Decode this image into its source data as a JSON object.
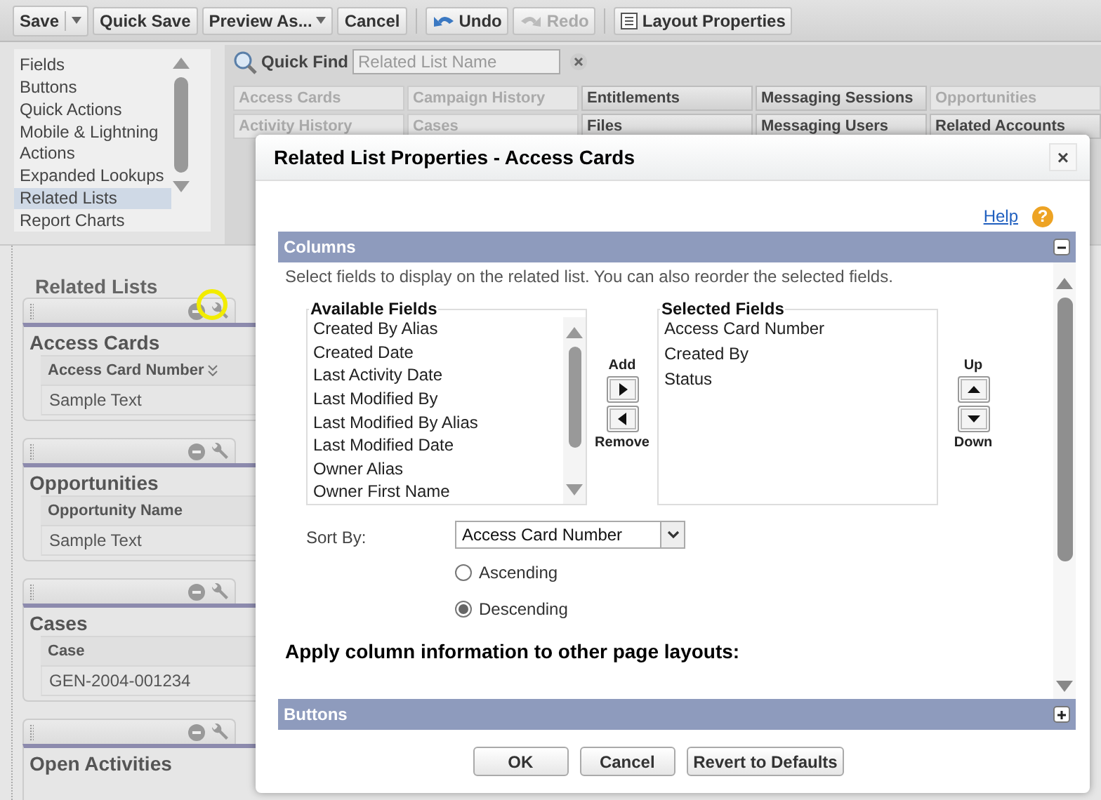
{
  "toolbar": {
    "groups": [
      [
        {
          "label": "Save",
          "kind": "split",
          "disabled": false
        },
        {
          "label": "Quick Save",
          "kind": "plain",
          "disabled": false
        },
        {
          "label": "Preview As...",
          "kind": "menu",
          "disabled": false
        },
        {
          "label": "Cancel",
          "kind": "plain",
          "disabled": false
        }
      ],
      [
        {
          "label": "Undo",
          "kind": "undo",
          "disabled": false
        },
        {
          "label": "Redo",
          "kind": "redo",
          "disabled": true
        }
      ],
      [
        {
          "label": "Layout Properties",
          "kind": "layout",
          "disabled": false
        }
      ]
    ]
  },
  "palette": {
    "categories": [
      {
        "label": "Fields",
        "selected": false
      },
      {
        "label": "Buttons",
        "selected": false
      },
      {
        "label": "Quick Actions",
        "selected": false
      },
      {
        "label": "Mobile & Lightning Actions",
        "selected": false
      },
      {
        "label": "Expanded Lookups",
        "selected": false
      },
      {
        "label": "Related Lists",
        "selected": true
      },
      {
        "label": "Report Charts",
        "selected": false
      }
    ],
    "quick_find": {
      "label": "Quick Find",
      "placeholder": "Related List Name"
    },
    "items": [
      {
        "label": "Access Cards",
        "in_use": true
      },
      {
        "label": "Campaign History",
        "in_use": true
      },
      {
        "label": "Entitlements",
        "in_use": false
      },
      {
        "label": "Messaging Sessions",
        "in_use": false
      },
      {
        "label": "Opportunities",
        "in_use": true
      },
      {
        "label": "Activity History",
        "in_use": true
      },
      {
        "label": "Cases",
        "in_use": true
      },
      {
        "label": "Files",
        "in_use": false
      },
      {
        "label": "Messaging Users",
        "in_use": false
      },
      {
        "label": "Related Accounts",
        "in_use": false
      }
    ]
  },
  "layout": {
    "section_title": "Related Lists",
    "related_lists": [
      {
        "title": "Access Cards",
        "column": "Access Card Number",
        "sorted": true,
        "value": "Sample Text",
        "highlighted": true
      },
      {
        "title": "Opportunities",
        "column": "Opportunity Name",
        "sorted": false,
        "value": "Sample Text",
        "highlighted": false
      },
      {
        "title": "Cases",
        "column": "Case",
        "sorted": false,
        "value": "GEN-2004-001234",
        "highlighted": false
      },
      {
        "title": "Open Activities",
        "highlighted": false
      }
    ]
  },
  "dialog": {
    "title": "Related List Properties - Access Cards",
    "close_glyph": "×",
    "help_link": "Help",
    "help_glyph": "?",
    "columns_section": {
      "title": "Columns",
      "expanded": true,
      "description": "Select fields to display on the related list. You can also reorder the selected fields.",
      "available_label": "Available Fields",
      "available_fields": [
        "Created By Alias",
        "Created Date",
        "Last Activity Date",
        "Last Modified By",
        "Last Modified By Alias",
        "Last Modified Date",
        "Owner Alias",
        "Owner First Name"
      ],
      "add_label": "Add",
      "remove_label": "Remove",
      "selected_label": "Selected Fields",
      "selected_fields": [
        "Access Card Number",
        "Created By",
        "Status"
      ],
      "up_label": "Up",
      "down_label": "Down",
      "sort_by_label": "Sort By:",
      "sort_by_value": "Access Card Number",
      "sort_orders": [
        {
          "label": "Ascending",
          "selected": false
        },
        {
          "label": "Descending",
          "selected": true
        }
      ],
      "apply_heading": "Apply column information to other page layouts:"
    },
    "buttons_section": {
      "title": "Buttons",
      "expanded": false
    },
    "footer_buttons": [
      "OK",
      "Cancel",
      "Revert to Defaults"
    ]
  }
}
